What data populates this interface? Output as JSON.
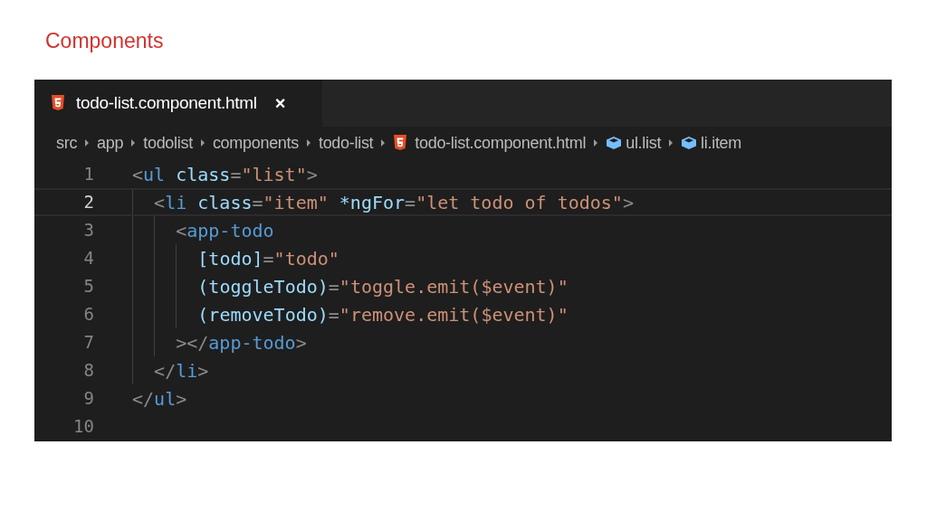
{
  "slide_title": "Components",
  "tab": {
    "label": "todo-list.component.html",
    "close": "×",
    "selected": true
  },
  "breadcrumbs": [
    {
      "kind": "folder",
      "label": "src"
    },
    {
      "kind": "folder",
      "label": "app"
    },
    {
      "kind": "folder",
      "label": "todolist"
    },
    {
      "kind": "folder",
      "label": "components"
    },
    {
      "kind": "folder",
      "label": "todo-list"
    },
    {
      "kind": "html",
      "label": "todo-list.component.html"
    },
    {
      "kind": "element",
      "label": "ul.list"
    },
    {
      "kind": "element",
      "label": "li.item"
    }
  ],
  "lines": [
    {
      "number": "1",
      "current": false,
      "tokens": [
        {
          "kind": "punct",
          "text": "<"
        },
        {
          "kind": "tag",
          "text": "ul "
        },
        {
          "kind": "attr",
          "text": "class"
        },
        {
          "kind": "punct",
          "text": "="
        },
        {
          "kind": "string",
          "text": "\"list\""
        },
        {
          "kind": "punct",
          "text": ">"
        }
      ],
      "children": [
        {
          "number": "2",
          "current": true,
          "tokens": [
            {
              "kind": "punct",
              "text": "<"
            },
            {
              "kind": "tag",
              "text": "li "
            },
            {
              "kind": "attr",
              "text": "class"
            },
            {
              "kind": "punct",
              "text": "="
            },
            {
              "kind": "string",
              "text": "\"item\" "
            },
            {
              "kind": "attr",
              "text": "*ngFor"
            },
            {
              "kind": "punct",
              "text": "="
            },
            {
              "kind": "string",
              "text": "\"let todo of todos\""
            },
            {
              "kind": "punct",
              "text": ">"
            }
          ],
          "children": [
            {
              "number": "3",
              "current": false,
              "tokens": [
                {
                  "kind": "punct",
                  "text": "<"
                },
                {
                  "kind": "tag",
                  "text": "app-todo"
                }
              ],
              "children": [
                {
                  "number": "4",
                  "current": false,
                  "tokens": [
                    {
                      "kind": "attr",
                      "text": "[todo]"
                    },
                    {
                      "kind": "punct",
                      "text": "="
                    },
                    {
                      "kind": "string",
                      "text": "\"todo\""
                    }
                  ]
                },
                {
                  "number": "5",
                  "current": false,
                  "tokens": [
                    {
                      "kind": "attr",
                      "text": "(toggleTodo)"
                    },
                    {
                      "kind": "punct",
                      "text": "="
                    },
                    {
                      "kind": "string",
                      "text": "\"toggle.emit($event)\""
                    }
                  ]
                },
                {
                  "number": "6",
                  "current": false,
                  "tokens": [
                    {
                      "kind": "attr",
                      "text": "(removeTodo)"
                    },
                    {
                      "kind": "punct",
                      "text": "="
                    },
                    {
                      "kind": "string",
                      "text": "\"remove.emit($event)\""
                    }
                  ]
                }
              ]
            },
            {
              "number": "7",
              "current": false,
              "tokens": [
                {
                  "kind": "punct",
                  "text": "></"
                },
                {
                  "kind": "tag",
                  "text": "app-todo"
                },
                {
                  "kind": "punct",
                  "text": ">"
                }
              ]
            }
          ]
        },
        {
          "number": "8",
          "current": false,
          "tokens": [
            {
              "kind": "punct",
              "text": "</"
            },
            {
              "kind": "tag",
              "text": "li"
            },
            {
              "kind": "punct",
              "text": ">"
            }
          ]
        }
      ]
    },
    {
      "number": "9",
      "current": false,
      "tokens": [
        {
          "kind": "punct",
          "text": "</"
        },
        {
          "kind": "tag",
          "text": "ul"
        },
        {
          "kind": "punct",
          "text": ">"
        }
      ]
    },
    {
      "number": "10",
      "current": false
    }
  ]
}
